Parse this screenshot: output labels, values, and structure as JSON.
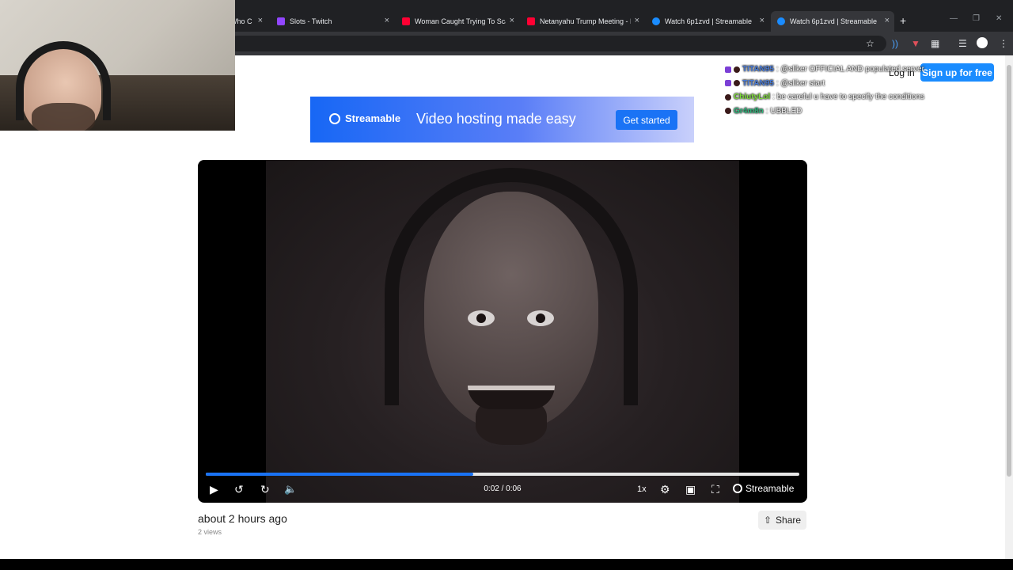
{
  "browser": {
    "tabs": [
      {
        "title": "Who C",
        "favicon_color": "#9aa0a6"
      },
      {
        "title": "Slots - Twitch",
        "favicon_color": "#9146ff"
      },
      {
        "title": "Woman Caught Trying To Scam",
        "favicon_color": "#ff0033"
      },
      {
        "title": "Netanyahu Trump Meeting - Li",
        "favicon_color": "#ff0033"
      },
      {
        "title": "Watch 6p1zvd | Streamable",
        "favicon_color": "#1a8cff"
      },
      {
        "title": "Watch 6p1zvd | Streamable",
        "favicon_color": "#1a8cff",
        "active": true
      }
    ],
    "close_glyph": "×",
    "new_tab_glyph": "+"
  },
  "header": {
    "login_label": "Log in",
    "signup_label": "Sign up for free"
  },
  "banner": {
    "logo_text": "Streamable",
    "tagline": "Video hosting made easy",
    "cta_label": "Get started",
    "accent": "#1767f5"
  },
  "chat": [
    {
      "user": "TITAN95",
      "user_color": "#4a7bd6",
      "message": ": @sliker OFFICIAL AND populated server"
    },
    {
      "user": "TITAN95",
      "user_color": "#4a7bd6",
      "message": ": @sliker start"
    },
    {
      "user": "ChiutyLol",
      "user_color": "#7ddc3a",
      "message": ": be careful u have to specify the conditions"
    },
    {
      "user": "Gr4m8n",
      "user_color": "#2fb67b",
      "message": ": UBBLED"
    }
  ],
  "player": {
    "current_time": "0:02",
    "duration": "0:06",
    "time_display": "0:02 / 0:06",
    "progress": 0.45,
    "speed_label": "1x",
    "brand_label": "Streamable",
    "icons": {
      "play": "play-icon",
      "rewind": "rewind-icon",
      "forward": "forward-icon",
      "volume": "volume-icon",
      "settings": "gear-icon",
      "pip": "pip-icon",
      "fullscreen": "fullscreen-icon"
    }
  },
  "video_meta": {
    "uploaded": "about 2 hours ago",
    "views": "2 views",
    "share_label": "Share"
  }
}
